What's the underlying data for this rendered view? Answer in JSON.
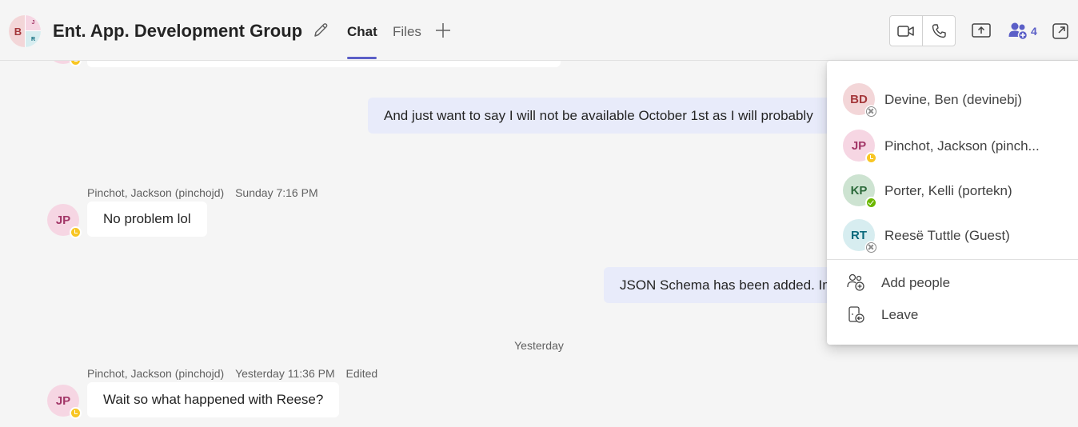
{
  "header": {
    "group_avatar_initials": [
      "B",
      "J",
      "R"
    ],
    "title": "Ent. App. Development Group",
    "tabs": [
      {
        "label": "Chat",
        "active": true
      },
      {
        "label": "Files",
        "active": false
      }
    ],
    "participant_count": "4",
    "accent_color": "#5b5fc7"
  },
  "chat": {
    "messages": [
      {
        "own": true,
        "text": "And just want to say I will not be available October 1st as I will probably"
      },
      {
        "author": "Pinchot, Jackson (pinchojd)",
        "time": "Sunday 7:16 PM",
        "initials": "JP",
        "presence": "away",
        "text": "No problem lol"
      },
      {
        "own": true,
        "text": "JSON Schema has been added. Im"
      },
      {
        "author": "Pinchot, Jackson (pinchojd)",
        "time": "Yesterday 11:36 PM",
        "edited": "Edited",
        "initials": "JP",
        "presence": "away",
        "text": "Wait so what happened with Reese?"
      }
    ],
    "date_divider": "Yesterday"
  },
  "participants_panel": {
    "people": [
      {
        "initials": "BD",
        "name": "Devine, Ben (devinebj)",
        "presence": "offline"
      },
      {
        "initials": "JP",
        "name": "Pinchot, Jackson (pinch...",
        "presence": "away"
      },
      {
        "initials": "KP",
        "name": "Porter, Kelli (portekn)",
        "presence": "available"
      },
      {
        "initials": "RT",
        "name": "Reesë Tuttle (Guest)",
        "presence": "offline"
      }
    ],
    "actions": [
      {
        "label": "Add people",
        "icon": "add-people-icon"
      },
      {
        "label": "Leave",
        "icon": "leave-icon"
      }
    ]
  }
}
